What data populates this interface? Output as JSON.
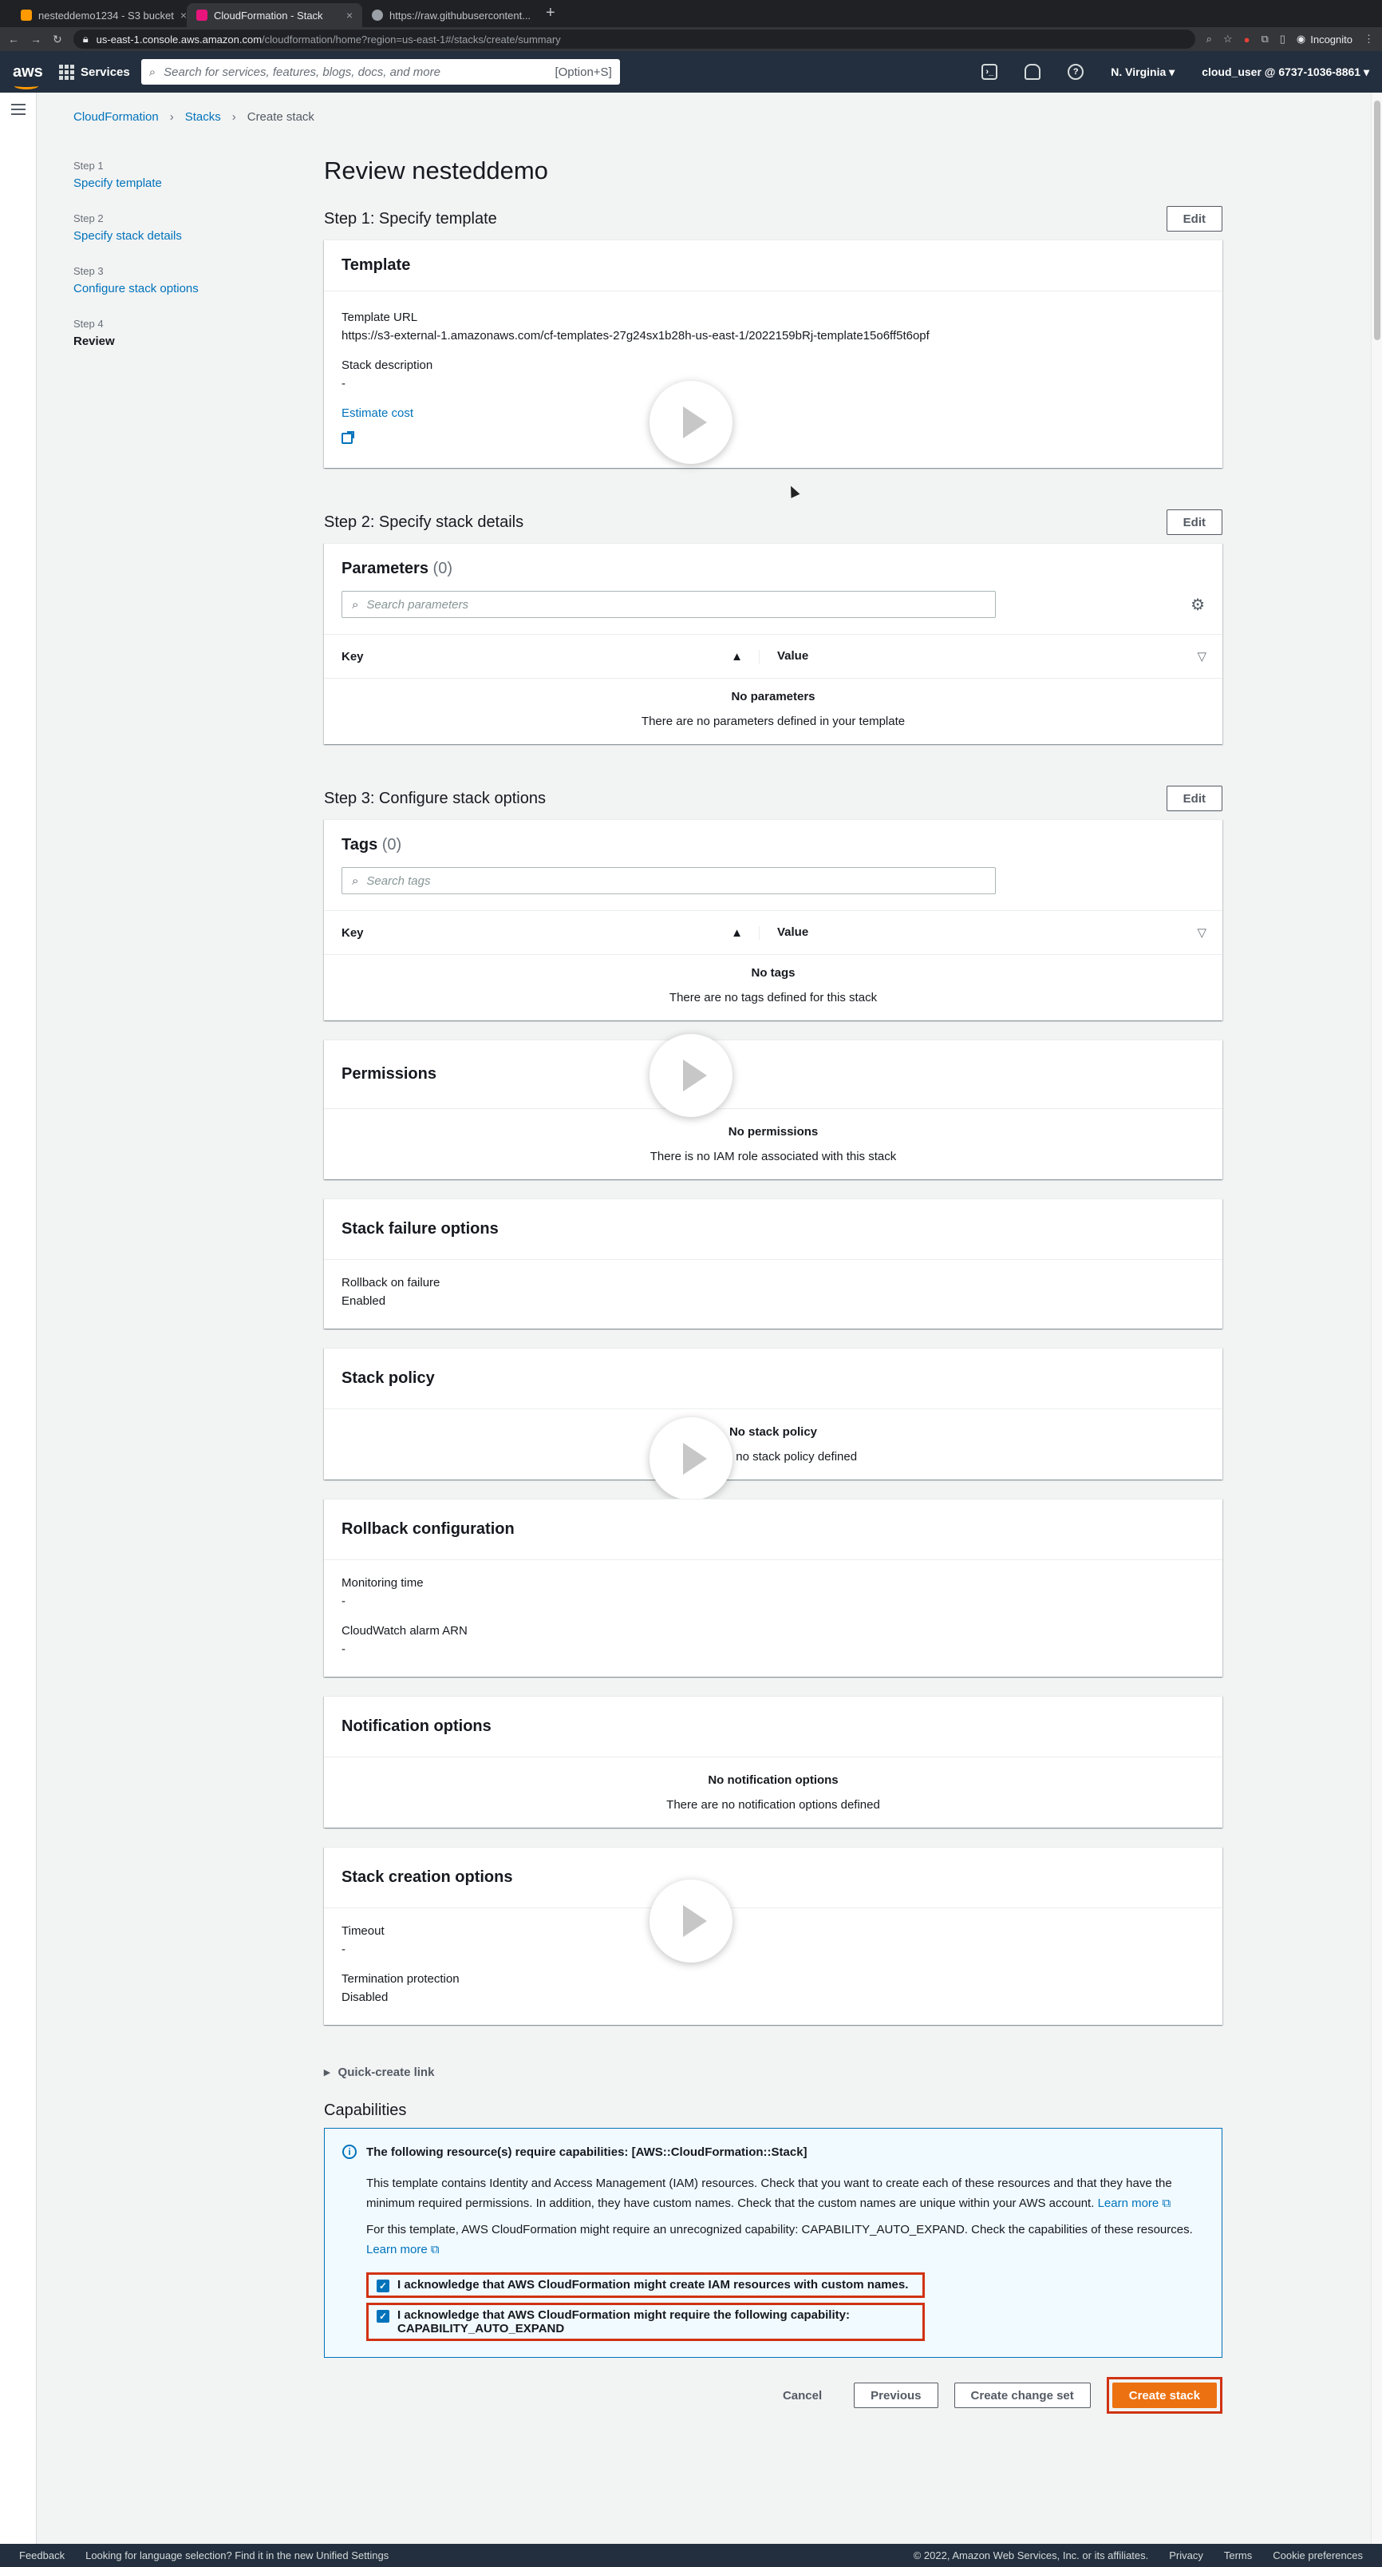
{
  "browser": {
    "tabs": [
      {
        "title": "nesteddemo1234 - S3 bucket",
        "color": "#ff9900"
      },
      {
        "title": "CloudFormation - Stack",
        "color": "#e7157b"
      },
      {
        "title": "https://raw.githubusercontent...",
        "color": "#9aa0a6"
      }
    ],
    "url_host": "us-east-1.console.aws.amazon.com",
    "url_path": "/cloudformation/home?region=us-east-1#/stacks/create/summary",
    "incognito": "Incognito"
  },
  "aws_nav": {
    "logo": "aws",
    "services": "Services",
    "search_placeholder": "Search for services, features, blogs, docs, and more",
    "search_shortcut": "[Option+S]",
    "region": "N. Virginia ▾",
    "account": "cloud_user @ 6737-1036-8861 ▾"
  },
  "breadcrumb": [
    "CloudFormation",
    "Stacks",
    "Create stack"
  ],
  "steps": [
    {
      "num": "Step 1",
      "label": "Specify template"
    },
    {
      "num": "Step 2",
      "label": "Specify stack details"
    },
    {
      "num": "Step 3",
      "label": "Configure stack options"
    },
    {
      "num": "Step 4",
      "label": "Review"
    }
  ],
  "page_title": "Review nesteddemo",
  "edit_label": "Edit",
  "step1": {
    "heading": "Step 1: Specify template",
    "card_title": "Template",
    "template_url_label": "Template URL",
    "template_url": "https://s3-external-1.amazonaws.com/cf-templates-27g24sx1b28h-us-east-1/2022159bRj-template15o6ff5t6opf",
    "stack_desc_label": "Stack description",
    "stack_desc": "-",
    "estimate_cost": "Estimate cost"
  },
  "step2": {
    "heading": "Step 2: Specify stack details",
    "card_title": "Parameters",
    "count": "(0)",
    "search_placeholder": "Search parameters",
    "col_key": "Key",
    "col_value": "Value",
    "empty_title": "No parameters",
    "empty_text": "There are no parameters defined in your template"
  },
  "step3": {
    "heading": "Step 3: Configure stack options",
    "tags_title": "Tags",
    "tags_count": "(0)",
    "tags_search": "Search tags",
    "col_key": "Key",
    "col_value": "Value",
    "tags_empty_title": "No tags",
    "tags_empty_text": "There are no tags defined for this stack",
    "perm_title": "Permissions",
    "perm_empty_title": "No permissions",
    "perm_empty_text": "There is no IAM role associated with this stack",
    "fail_title": "Stack failure options",
    "rollback_label": "Rollback on failure",
    "rollback_value": "Enabled",
    "policy_title": "Stack policy",
    "policy_empty_title": "No stack policy",
    "policy_empty_text": "There is no stack policy defined",
    "rbconf_title": "Rollback configuration",
    "monitor_label": "Monitoring time",
    "monitor_value": "-",
    "alarm_label": "CloudWatch alarm ARN",
    "alarm_value": "-",
    "notif_title": "Notification options",
    "notif_empty_title": "No notification options",
    "notif_empty_text": "There are no notification options defined",
    "creation_title": "Stack creation options",
    "timeout_label": "Timeout",
    "timeout_value": "-",
    "term_label": "Termination protection",
    "term_value": "Disabled"
  },
  "quick_create": "Quick-create link",
  "capabilities": {
    "heading": "Capabilities",
    "alert_title": "The following resource(s) require capabilities: [AWS::CloudFormation::Stack]",
    "p1": "This template contains Identity and Access Management (IAM) resources. Check that you want to create each of these resources and that they have the minimum required permissions. In addition, they have custom names. Check that the custom names are unique within your AWS account.",
    "p1_link": "Learn more",
    "p2": "For this template, AWS CloudFormation might require an unrecognized capability: CAPABILITY_AUTO_EXPAND. Check the capabilities of these resources.",
    "p2_link": "Learn more",
    "ack1": "I acknowledge that AWS CloudFormation might create IAM resources with custom names.",
    "ack2": "I acknowledge that AWS CloudFormation might require the following capability: CAPABILITY_AUTO_EXPAND"
  },
  "actions": {
    "cancel": "Cancel",
    "previous": "Previous",
    "change_set": "Create change set",
    "create": "Create stack"
  },
  "footer": {
    "feedback": "Feedback",
    "lang": "Looking for language selection? Find it in the new Unified Settings",
    "copyright": "© 2022, Amazon Web Services, Inc. or its affiliates.",
    "privacy": "Privacy",
    "terms": "Terms",
    "cookies": "Cookie preferences"
  },
  "colors": {
    "accent": "#0073bb",
    "primary": "#ec7211",
    "nav": "#232f3e",
    "highlight": "#d13212"
  }
}
